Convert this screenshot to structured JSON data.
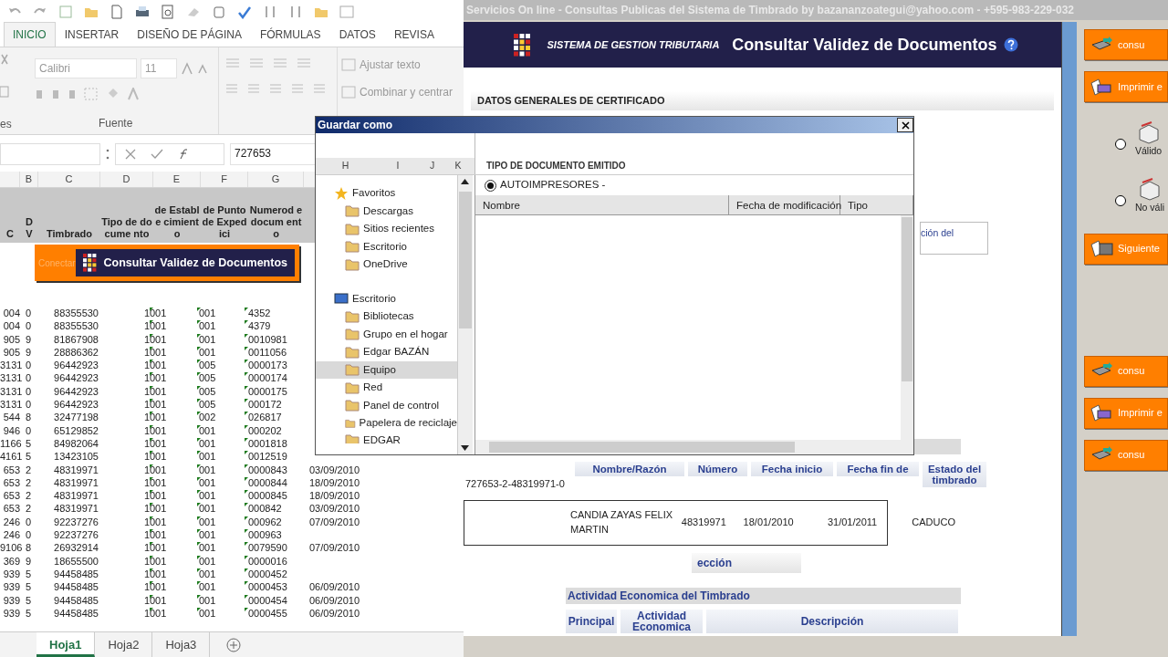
{
  "excel": {
    "ribbon_tabs": [
      {
        "label": "INICIO",
        "selected": true
      },
      {
        "label": "INSERTAR",
        "selected": false
      },
      {
        "label": "DISEÑO DE PÁGINA",
        "selected": false
      },
      {
        "label": "FÓRMULAS",
        "selected": false
      },
      {
        "label": "DATOS",
        "selected": false
      },
      {
        "label": "REVISA",
        "selected": false
      }
    ],
    "font_name": "Calibri",
    "font_size": "11",
    "ribbon_buttons": [
      "Ajustar texto",
      "Combinar y centrar"
    ],
    "group_labels": [
      "es",
      "Fuente"
    ],
    "formula_value": "727653",
    "column_letters": [
      "B",
      "C",
      "D",
      "E",
      "F",
      "G"
    ],
    "headers": [
      "C",
      "D V",
      "Timbrado",
      "Tipo de docume nto",
      "de Estable cimient o",
      "de Punto de Expedici",
      "Numerod edocum ento"
    ],
    "connect_label": "Conectar",
    "consult_button": "Consultar Validez de Documentos",
    "rows": [
      [
        "004",
        "0",
        "88355530",
        "1",
        "001",
        "001",
        "4352"
      ],
      [
        "004",
        "0",
        "88355530",
        "1",
        "001",
        "001",
        "4379"
      ],
      [
        "905",
        "9",
        "81867908",
        "1",
        "001",
        "001",
        "0010981"
      ],
      [
        "905",
        "9",
        "28886362",
        "1",
        "001",
        "001",
        "0011056"
      ],
      [
        "3131",
        "0",
        "96442923",
        "1",
        "001",
        "005",
        "0000173"
      ],
      [
        "3131",
        "0",
        "96442923",
        "1",
        "001",
        "005",
        "0000174"
      ],
      [
        "3131",
        "0",
        "96442923",
        "1",
        "001",
        "005",
        "0000175"
      ],
      [
        "3131",
        "0",
        "96442923",
        "1",
        "001",
        "005",
        "000172"
      ],
      [
        "544",
        "8",
        "32477198",
        "1",
        "001",
        "002",
        "026817"
      ],
      [
        "946",
        "0",
        "65129852",
        "1",
        "001",
        "001",
        "000202"
      ],
      [
        "1166",
        "5",
        "84982064",
        "1",
        "001",
        "001",
        "0001818"
      ],
      [
        "4161",
        "5",
        "13423105",
        "1",
        "001",
        "001",
        "0012519"
      ],
      [
        "653",
        "2",
        "48319971",
        "1",
        "001",
        "001",
        "0000843",
        "03/09/2010"
      ],
      [
        "653",
        "2",
        "48319971",
        "1",
        "001",
        "001",
        "0000844",
        "18/09/2010"
      ],
      [
        "653",
        "2",
        "48319971",
        "1",
        "001",
        "001",
        "0000845",
        "18/09/2010"
      ],
      [
        "653",
        "2",
        "48319971",
        "1",
        "001",
        "001",
        "000842",
        "03/09/2010"
      ],
      [
        "246",
        "0",
        "92237276",
        "1",
        "001",
        "001",
        "000962",
        "07/09/2010"
      ],
      [
        "246",
        "0",
        "92237276",
        "1",
        "001",
        "001",
        "000963"
      ],
      [
        "9106",
        "8",
        "26932914",
        "1",
        "001",
        "001",
        "0079590",
        "07/09/2010"
      ],
      [
        "369",
        "9",
        "18655500",
        "1",
        "001",
        "001",
        "0000016"
      ],
      [
        "939",
        "5",
        "94458485",
        "1",
        "001",
        "001",
        "0000452"
      ],
      [
        "939",
        "5",
        "94458485",
        "1",
        "001",
        "001",
        "0000453",
        "06/09/2010"
      ],
      [
        "939",
        "5",
        "94458485",
        "1",
        "001",
        "001",
        "0000454",
        "06/09/2010"
      ],
      [
        "939",
        "5",
        "94458485",
        "1",
        "001",
        "001",
        "0000455",
        "06/09/2010"
      ]
    ],
    "sheet_tabs": [
      {
        "label": "Hoja1",
        "selected": true
      },
      {
        "label": "Hoja2",
        "selected": false
      },
      {
        "label": "Hoja3",
        "selected": false
      }
    ]
  },
  "browser": {
    "title": "Servicios On line - Consultas Publicas del Sistema de Timbrado by bazananzoategui@yahoo.com - +595-983-229-032",
    "system_name": "SISTEMA DE GESTION TRIBUTARIA",
    "page_title": "Consultar Validez de Documentos",
    "section": "DATOS GENERALES DE CERTIFICADO",
    "fragment": "ción del",
    "result_code": "727653-2-48319971-0",
    "result_columns": [
      "Nombre/Razón",
      "Número",
      "Fecha inicio",
      "Fecha fin de",
      "Estado del timbrado"
    ],
    "result_row": [
      "CANDIA ZAYAS FELIX MARTIN",
      "48319971",
      "18/01/2010",
      "31/01/2011",
      "CADUCO"
    ],
    "address_button": "ección",
    "activity_title": "Actividad Economica del Timbrado",
    "activity_columns": [
      "Principal",
      "Actividad Economica",
      "Descripción"
    ]
  },
  "side_panel": [
    {
      "kind": "send",
      "label": "consu"
    },
    {
      "kind": "print",
      "label": "Imprimir e"
    },
    {
      "kind": "radio",
      "label": "Válido",
      "selected": false
    },
    {
      "kind": "radio",
      "label": "No váli",
      "selected": false
    },
    {
      "kind": "next",
      "label": "Siguiente"
    },
    {
      "kind": "send",
      "label": "consu"
    },
    {
      "kind": "print",
      "label": "Imprimir e"
    },
    {
      "kind": "send",
      "label": "consu"
    }
  ],
  "dialog": {
    "title": "Guardar como",
    "ghost_heading": "TIPO DE DOCUMENTO EMITIDO",
    "ghost_columns": [
      "H",
      "I",
      "J",
      "K"
    ],
    "ghost_radio": {
      "label": "AUTOIMPRESORES -",
      "selected": true
    },
    "nav": [
      {
        "label": "Favoritos",
        "selected": false,
        "children": [
          {
            "label": "Descargas",
            "selected": false
          },
          {
            "label": "Sitios recientes",
            "selected": false
          },
          {
            "label": "Escritorio",
            "selected": false
          },
          {
            "label": "OneDrive",
            "selected": false
          }
        ]
      },
      {
        "label": "Escritorio",
        "selected": false,
        "children": [
          {
            "label": "Bibliotecas",
            "selected": false
          },
          {
            "label": "Grupo en el hogar",
            "selected": false
          },
          {
            "label": "Edgar BAZÁN",
            "selected": false
          },
          {
            "label": "Equipo",
            "selected": true
          },
          {
            "label": "Red",
            "selected": false
          },
          {
            "label": "Panel de control",
            "selected": false
          },
          {
            "label": "Papelera de reciclaje",
            "selected": false
          },
          {
            "label": "EDGAR",
            "selected": false
          }
        ]
      }
    ],
    "file_columns": [
      "Nombre",
      "Fecha de modificación",
      "Tipo"
    ]
  }
}
